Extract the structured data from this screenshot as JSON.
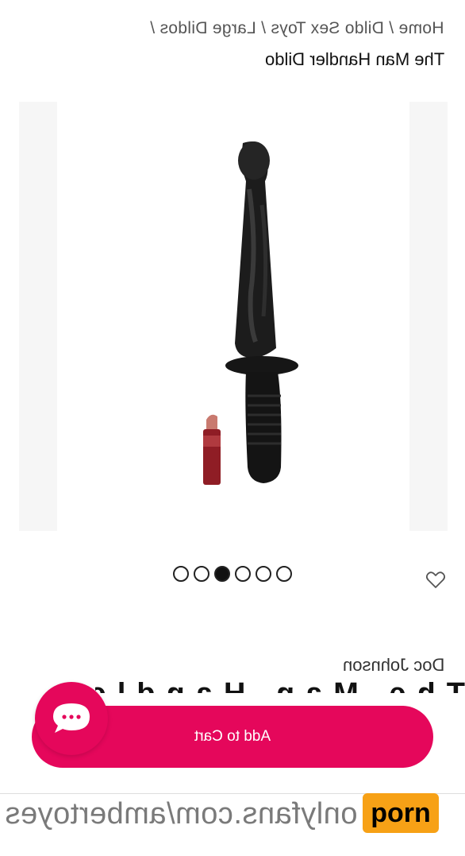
{
  "breadcrumb": "Home / Dildo Sex Toys /  Large Dildos /",
  "page_title": "The Man Handler Dildo",
  "gallery": {
    "slide_count": 6,
    "active_slide": 3
  },
  "brand": "Doc Johnson",
  "truncated_title": "The Man Handler Dildo",
  "cart_button_label": "Add to Cart",
  "watermark_url": "onlyfans.com/ambertoyes",
  "site_logo": "porn",
  "colors": {
    "accent": "#e5075b",
    "logo_bg": "#f7a116"
  },
  "icons": [
    "heart-icon",
    "chat-icon"
  ]
}
